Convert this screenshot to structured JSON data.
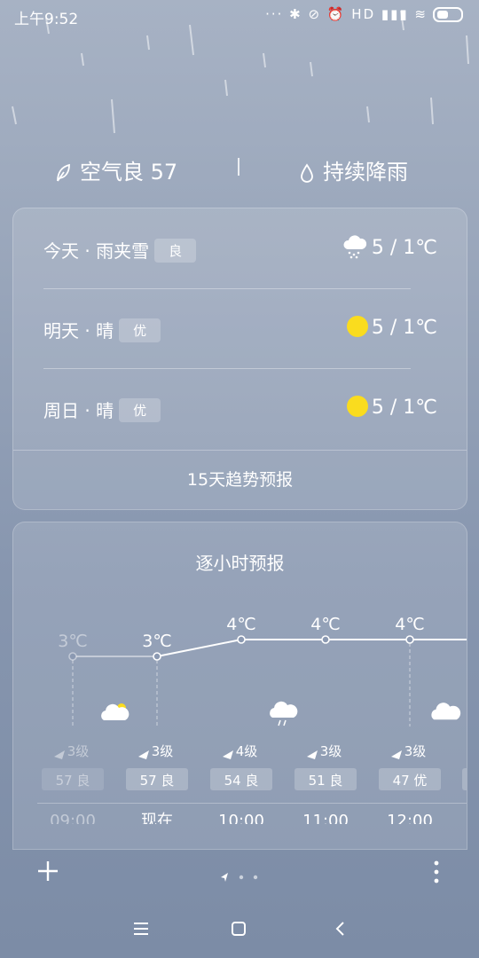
{
  "status_bar": {
    "time": "上午9:52",
    "indicators": "··· ✱ ⊘ ⏰ HD ▮▮▮ ≋"
  },
  "summary": {
    "air_quality": "空气良 57",
    "weather_note": "持续降雨"
  },
  "daily": [
    {
      "name": "今天 · 雨夹雪",
      "badge": "良",
      "temp": "5 / 1℃",
      "icon": "sleet-cloud-icon"
    },
    {
      "name": "明天 · 晴",
      "badge": "优",
      "temp": "5 / 1℃",
      "icon": "sun-icon"
    },
    {
      "name": "周日 · 晴",
      "badge": "优",
      "temp": "5 / 1℃",
      "icon": "sun-icon"
    }
  ],
  "trend_label": "15天趋势预报",
  "hourly": {
    "title": "逐小时预报",
    "items": [
      {
        "time": "09:00",
        "temp": "3℃",
        "wind": "3级",
        "aqi": "57 良",
        "icon": "partly-cloudy-icon",
        "faded": true
      },
      {
        "time": "现在",
        "temp": "3℃",
        "wind": "3级",
        "aqi": "57 良",
        "icon": "",
        "faded": false
      },
      {
        "time": "10:00",
        "temp": "4℃",
        "wind": "4级",
        "aqi": "54 良",
        "icon": "",
        "faded": false
      },
      {
        "time": "11:00",
        "temp": "4℃",
        "wind": "3级",
        "aqi": "51 良",
        "icon": "rain-cloud-icon",
        "faded": false
      },
      {
        "time": "12:00",
        "temp": "4℃",
        "wind": "3级",
        "aqi": "47 优",
        "icon": "",
        "faded": false
      }
    ]
  },
  "colors": {
    "sun": "#fadc1e",
    "sky_top": "#a7b2c4",
    "sky_bottom": "#7c8ca6"
  }
}
